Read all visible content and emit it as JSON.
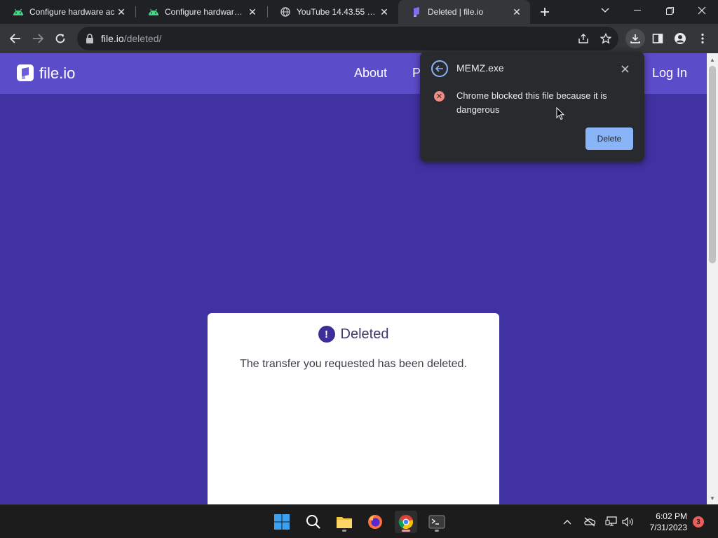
{
  "tabs": [
    {
      "title": "Configure hardware ac",
      "icon": "android-icon",
      "active": false
    },
    {
      "title": "Configure hardware ac",
      "icon": "android-icon",
      "active": false
    },
    {
      "title": "YouTube 14.43.55 (x86)",
      "icon": "globe-icon",
      "active": false
    },
    {
      "title": "Deleted | file.io",
      "icon": "fileio-icon",
      "active": true
    }
  ],
  "address_bar": {
    "host": "file.io",
    "path": "/deleted/"
  },
  "site": {
    "brand": "file.io",
    "nav": {
      "about": "About",
      "partial": "P",
      "login": "Log In"
    },
    "card": {
      "title": "Deleted",
      "message": "The transfer you requested has been deleted."
    }
  },
  "download_bubble": {
    "filename": "MEMZ.exe",
    "warning": "Chrome blocked this file because it is dangerous",
    "delete_label": "Delete"
  },
  "taskbar": {
    "time": "6:02 PM",
    "date": "7/31/2023",
    "notification_count": "3"
  },
  "colors": {
    "page_bg": "#4032a2",
    "navbar_bg": "#5b4cc9",
    "delete_button": "#8ab4f8",
    "error_icon": "#f28b82"
  }
}
